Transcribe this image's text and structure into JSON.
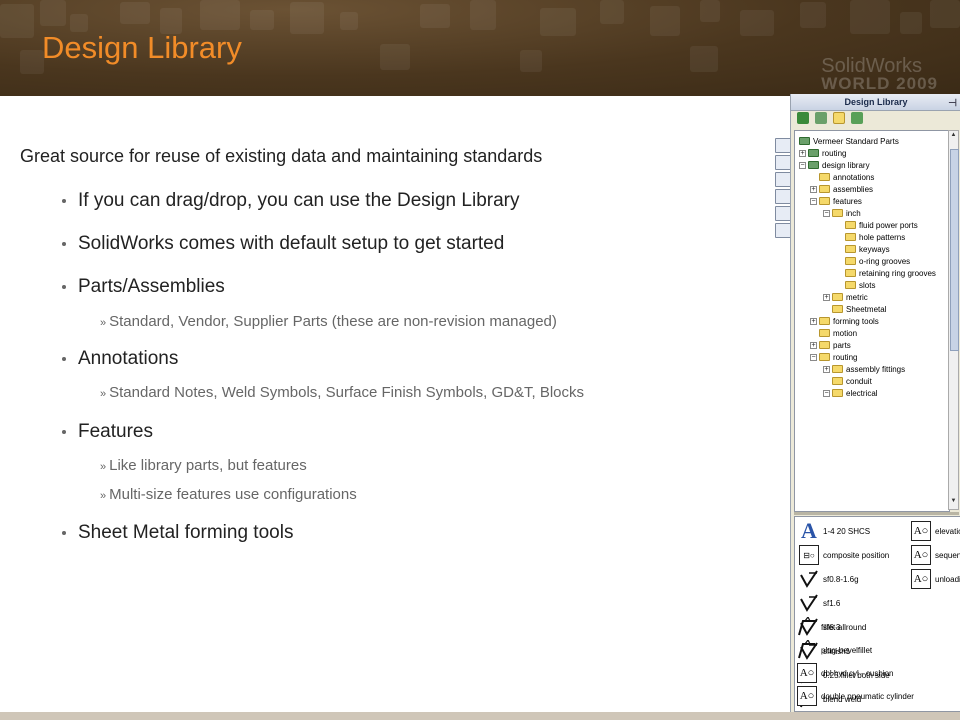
{
  "slide": {
    "title": "Design Library",
    "lead": "Great source for reuse of existing data and maintaining standards",
    "bullets": [
      "If you can drag/drop, you can use the Design Library",
      "SolidWorks comes with default setup to get started",
      "Parts/Assemblies",
      "Annotations",
      "Features",
      "Sheet Metal forming tools"
    ],
    "subbullets": {
      "parts": [
        "Standard, Vendor, Supplier Parts (these are non-revision managed)"
      ],
      "annotations": [
        "Standard Notes, Weld Symbols, Surface Finish Symbols, GD&T, Blocks"
      ],
      "features": [
        "Like library parts, but features",
        "Multi-size features use configurations"
      ]
    },
    "accent": "#F28C28",
    "header_bg": "#4A361E"
  },
  "logo": {
    "line1": "SolidWorks",
    "line2": "WORLD 2009"
  },
  "panel": {
    "title": "Design Library",
    "tree": [
      "Vermeer Standard Parts",
      "routing",
      "design library",
      "annotations",
      "assemblies",
      "features",
      "inch",
      "fluid power ports",
      "hole patterns",
      "keyways",
      "o-ring grooves",
      "retaining ring grooves",
      "slots",
      "metric",
      "Sheetmetal",
      "forming tools",
      "motion",
      "parts",
      "routing",
      "assembly fittings",
      "conduit",
      "electrical"
    ],
    "items_left": [
      "1-4 20 SHCS",
      "composite position",
      "sf0.8-1.6g",
      "sf1.6",
      "sf6.3",
      "sfinish1",
      "0.25 fillet both side",
      "blend weld",
      "fillet-allround",
      "plug-bevelfillet",
      "dbl hyd cyl - cushion",
      "double pneumatic cylinder"
    ],
    "items_right": [
      "elevatio",
      "sequen",
      "unloadi"
    ]
  }
}
